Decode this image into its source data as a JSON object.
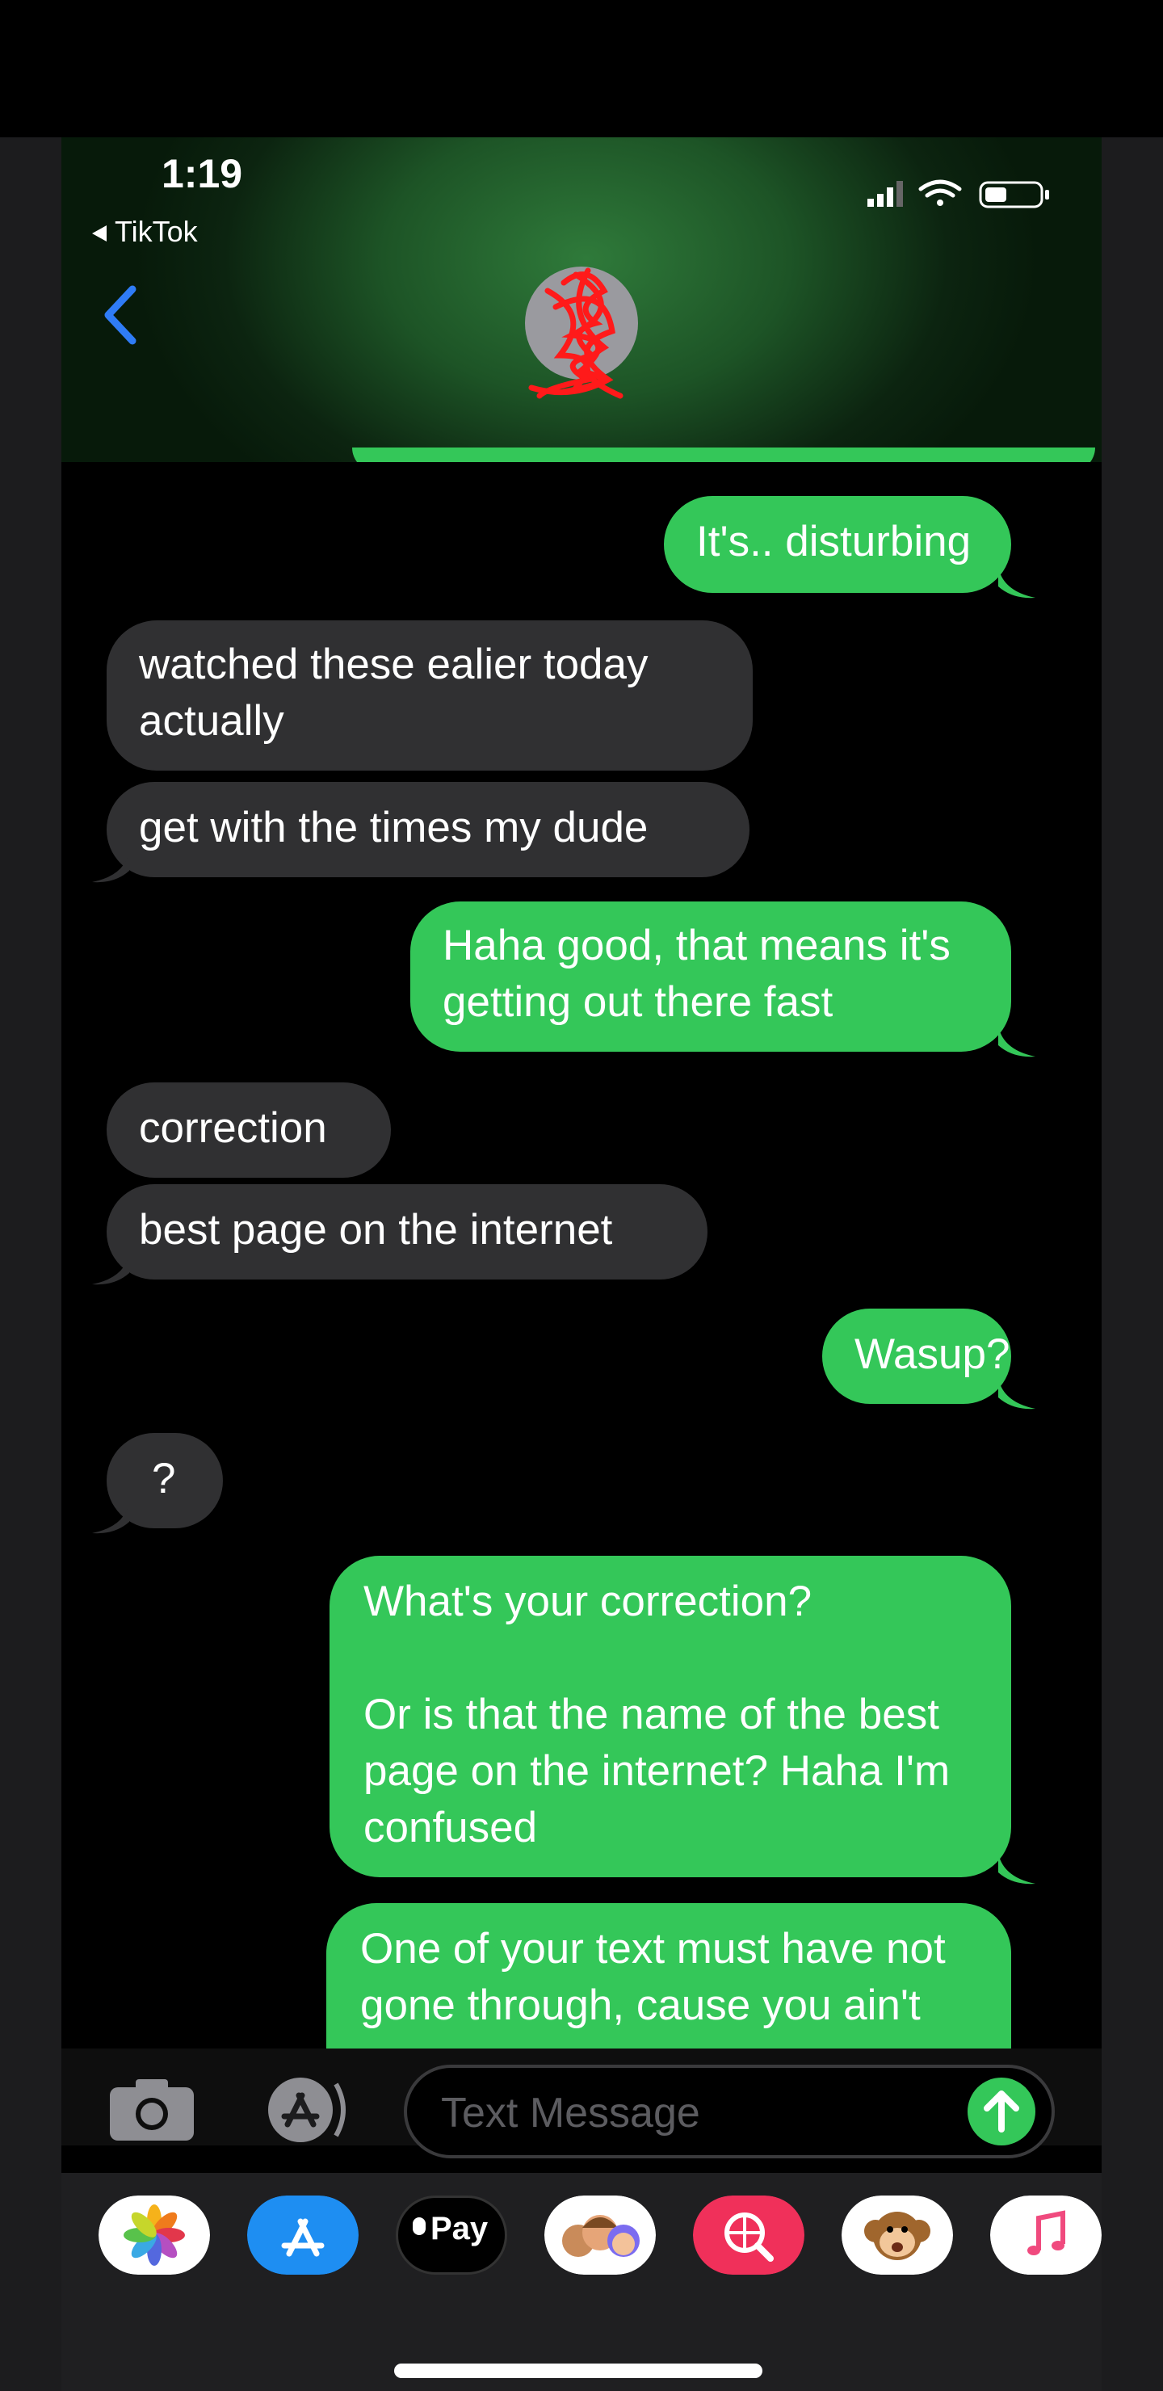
{
  "status_bar": {
    "time": "1:19",
    "back_app_label": "TikTok"
  },
  "messages": [
    {
      "side": "sent",
      "text": "It's.. disturbing"
    },
    {
      "side": "recv",
      "text": "watched these ealier today\nactually"
    },
    {
      "side": "recv",
      "text": "get with the times my dude"
    },
    {
      "side": "sent",
      "text": "Haha good, that means it's\ngetting out there fast"
    },
    {
      "side": "recv",
      "text": "correction"
    },
    {
      "side": "recv",
      "text": "best page on the internet"
    },
    {
      "side": "sent",
      "text": "Wasup?"
    },
    {
      "side": "recv",
      "text": "?"
    },
    {
      "side": "sent",
      "text": "What's your correction?\n\nOr is that the name of the best\npage on the internet? Haha I'm\nconfused"
    },
    {
      "side": "sent",
      "text": "One of your text must have not\ngone through, cause you ain't"
    }
  ],
  "input": {
    "placeholder": "Text Message"
  },
  "app_strip": [
    {
      "icon": "photos-icon",
      "color": "#ffffff"
    },
    {
      "icon": "app-store-icon",
      "color": "#1e8ef2"
    },
    {
      "icon": "apple-pay-icon",
      "color": "#000000",
      "label": "Pay"
    },
    {
      "icon": "memoji-icon",
      "color": "#ffffff"
    },
    {
      "icon": "web-search-icon",
      "color": "#f0305a"
    },
    {
      "icon": "animoji-monkey-icon",
      "color": "#ffffff"
    },
    {
      "icon": "music-icon",
      "color": "#ffffff"
    }
  ],
  "colors": {
    "sent_bubble": "#34c759",
    "received_bubble": "#303032",
    "accent_blue": "#2f7cf6"
  }
}
